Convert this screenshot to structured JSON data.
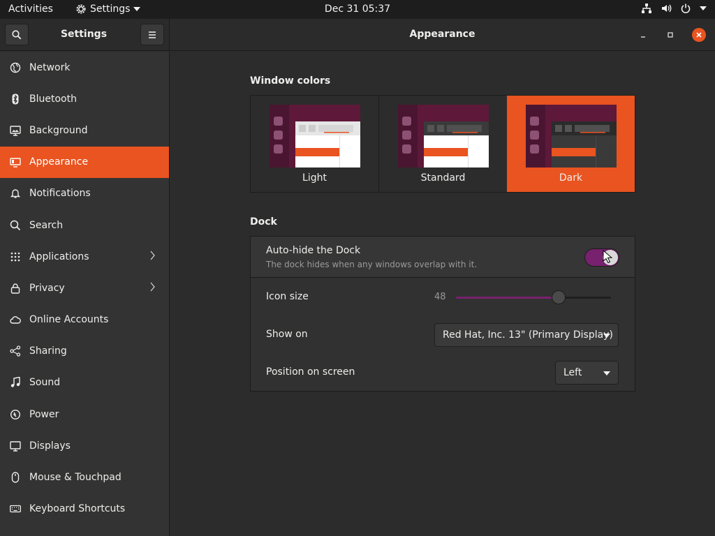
{
  "topbar": {
    "activities": "Activities",
    "app_name": "Settings",
    "clock": "Dec 31  05:37",
    "tray_icons": [
      "network-wired-icon",
      "volume-icon",
      "power-icon",
      "chevron-down-icon"
    ]
  },
  "header": {
    "sidebar_title": "Settings",
    "page_title": "Appearance",
    "search_icon": "search-icon",
    "menu_icon": "hamburger-icon",
    "window_buttons": [
      "minimize-icon",
      "maximize-icon",
      "close-icon"
    ]
  },
  "sidebar": {
    "items": [
      {
        "label": "Network",
        "icon": "network-icon"
      },
      {
        "label": "Bluetooth",
        "icon": "bluetooth-icon"
      },
      {
        "label": "Background",
        "icon": "background-icon"
      },
      {
        "label": "Appearance",
        "icon": "appearance-icon",
        "active": true
      },
      {
        "label": "Notifications",
        "icon": "bell-icon"
      },
      {
        "label": "Search",
        "icon": "search-icon"
      },
      {
        "label": "Applications",
        "icon": "grid-icon",
        "has_chevron": true
      },
      {
        "label": "Privacy",
        "icon": "lock-icon",
        "has_chevron": true
      },
      {
        "label": "Online Accounts",
        "icon": "cloud-icon"
      },
      {
        "label": "Sharing",
        "icon": "share-icon"
      },
      {
        "label": "Sound",
        "icon": "music-note-icon"
      },
      {
        "label": "Power",
        "icon": "power-icon"
      },
      {
        "label": "Displays",
        "icon": "display-icon"
      },
      {
        "label": "Mouse & Touchpad",
        "icon": "mouse-icon"
      },
      {
        "label": "Keyboard Shortcuts",
        "icon": "keyboard-icon"
      }
    ]
  },
  "appearance": {
    "window_colors_title": "Window colors",
    "choices": [
      {
        "label": "Light"
      },
      {
        "label": "Standard"
      },
      {
        "label": "Dark",
        "selected": true
      }
    ],
    "dock_title": "Dock",
    "autohide_label": "Auto-hide the Dock",
    "autohide_sub": "The dock hides when any windows overlap with it.",
    "autohide_on": true,
    "icon_size_label": "Icon size",
    "icon_size_value": "48",
    "icon_size_fraction": 0.66,
    "show_on_label": "Show on",
    "show_on_value": "Red Hat, Inc. 13\" (Primary Display)",
    "position_label": "Position on screen",
    "position_value": "Left"
  },
  "colors": {
    "accent": "#e95420",
    "toggle_on": "#77216f",
    "background": "#2c2c2c",
    "sidebar": "#333333"
  }
}
